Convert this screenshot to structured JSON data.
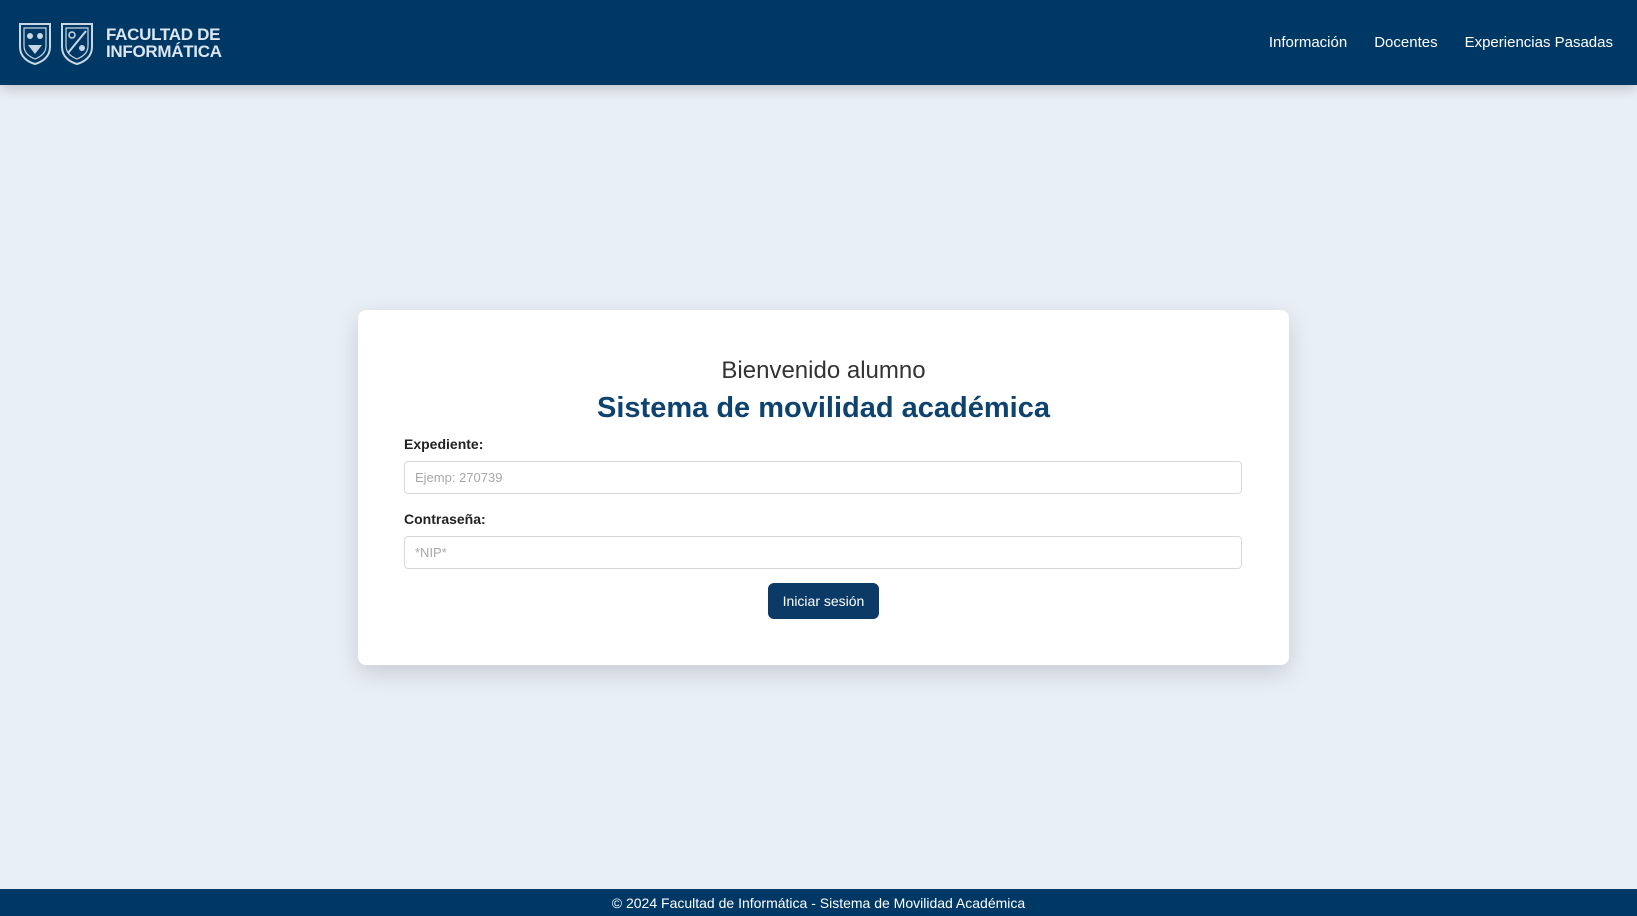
{
  "brand": {
    "line1": "FACULTAD DE",
    "line2": "INFORMÁTICA",
    "crest_left_icon": "university-shield-icon",
    "crest_right_icon": "faculty-shield-icon"
  },
  "nav": {
    "items": [
      {
        "label": "Información"
      },
      {
        "label": "Docentes"
      },
      {
        "label": "Experiencias Pasadas"
      }
    ]
  },
  "login": {
    "welcome": "Bienvenido alumno",
    "title": "Sistema de movilidad académica",
    "expediente_label": "Expediente:",
    "expediente_placeholder": "Ejemp: 270739",
    "expediente_value": "",
    "password_label": "Contraseña:",
    "password_placeholder": "*NIP*",
    "password_value": "",
    "submit_label": "Iniciar sesión"
  },
  "footer": {
    "text": "© 2024 Facultad de Informática - Sistema de Movilidad Académica"
  },
  "colors": {
    "navbar": "#003865",
    "page_background": "#e9eff7",
    "title": "#0e426f",
    "button": "#0c3a66"
  }
}
